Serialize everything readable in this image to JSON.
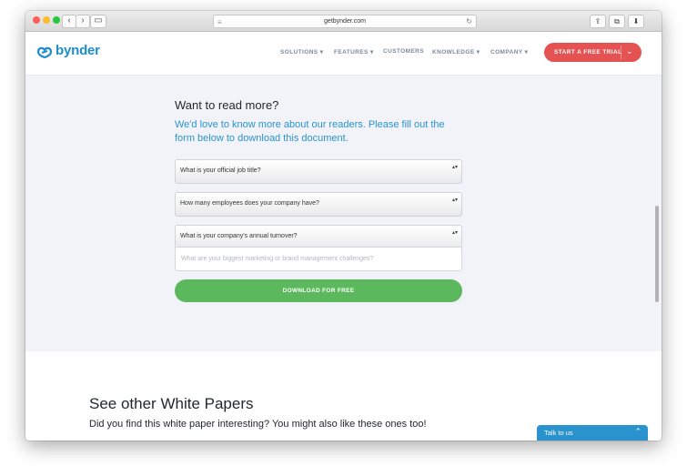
{
  "browser": {
    "url": "getbynder.com",
    "back_icon": "‹",
    "forward_icon": "›",
    "sidebar_icon": "▭",
    "share_icon": "⇪",
    "tabs_icon": "⧉",
    "download_icon": "⬇",
    "reload_icon": "↻",
    "reader_icon": "≡"
  },
  "header": {
    "logo_text": "bynder",
    "brand_color": "#1e8ecb",
    "nav": [
      "SOLUTIONS ▾",
      "FEATURES ▾",
      "CUSTOMERS",
      "KNOWLEDGE ▾",
      "COMPANY ▾"
    ],
    "cta_label": "START A FREE TRIAL",
    "cta_chevron": "⌄",
    "cta_color": "#e55252"
  },
  "form": {
    "title": "Want to read more?",
    "subtitle": "We'd love to know more about our readers. Please fill out the form below to download this document.",
    "selects": [
      "What is your official job title?",
      "How many employees does your company have?",
      "What is your company's annual turnover?"
    ],
    "select_arrows": "▴▾",
    "challenges_placeholder": "What are your biggest marketing or brand management challenges?",
    "download_label": "DOWNLOAD FOR FREE",
    "download_color": "#5cb85c"
  },
  "papers": {
    "title": "See other White Papers",
    "subtitle": "Did you find this white paper interesting? You might also like these ones too!"
  },
  "chat": {
    "label": "Talk to us",
    "chevron": "⌃"
  }
}
